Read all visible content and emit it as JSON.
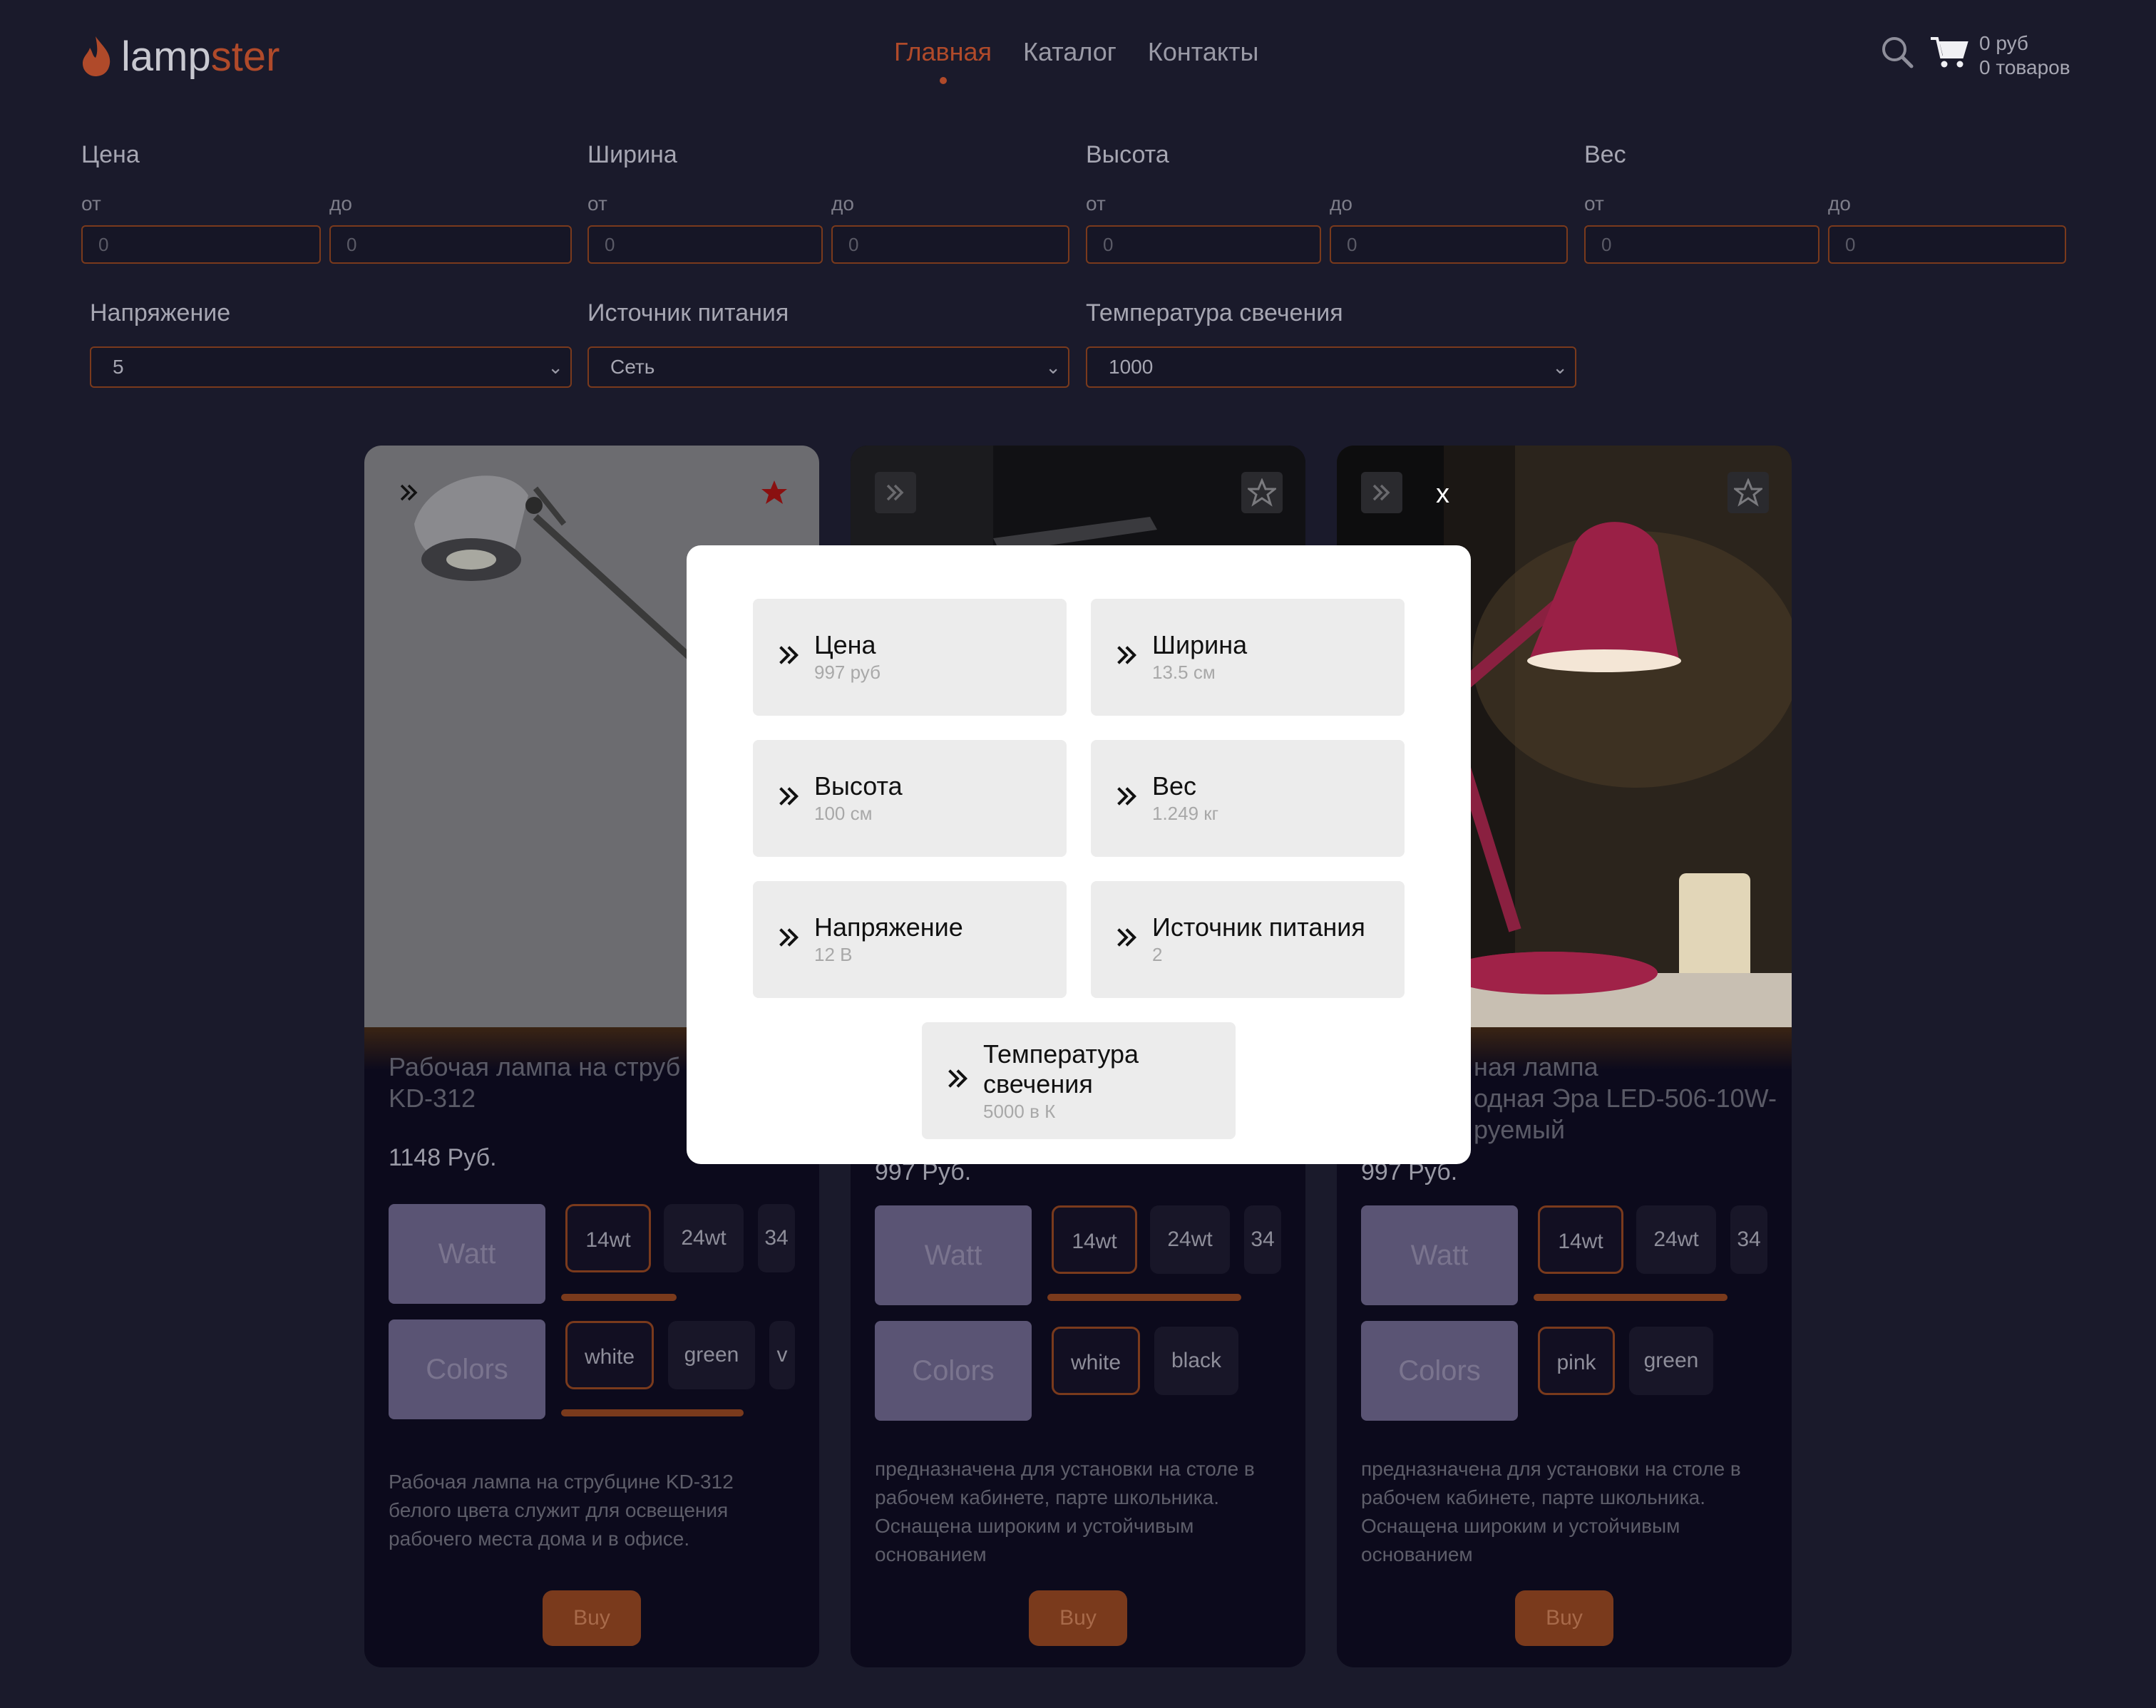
{
  "header": {
    "logo_part1": "lamp",
    "logo_part2": "ster",
    "nav": [
      {
        "label": "Главная",
        "active": true
      },
      {
        "label": "Каталог",
        "active": false
      },
      {
        "label": "Контакты",
        "active": false
      }
    ],
    "cart_total": "0 руб",
    "cart_count": "0 товаров",
    "icons": [
      "search-icon",
      "cart-icon"
    ]
  },
  "filters": {
    "ranges": [
      {
        "label": "Цена",
        "from_label": "от",
        "to_label": "до",
        "from_placeholder": "0",
        "to_placeholder": "0"
      },
      {
        "label": "Ширина",
        "from_label": "от",
        "to_label": "до",
        "from_placeholder": "0",
        "to_placeholder": "0"
      },
      {
        "label": "Высота",
        "from_label": "от",
        "to_label": "до",
        "from_placeholder": "0",
        "to_placeholder": "0"
      },
      {
        "label": "Вес",
        "from_label": "от",
        "to_label": "до",
        "from_placeholder": "0",
        "to_placeholder": "0"
      }
    ],
    "selects": [
      {
        "label": "Напряжение",
        "value": "5"
      },
      {
        "label": "Источник питания",
        "value": "Сеть"
      },
      {
        "label": "Температура свечения",
        "value": "1000"
      }
    ]
  },
  "cards": [
    {
      "title_line1": "Рабочая лампа на струб",
      "title_line2": "KD-312",
      "price": "1148 Руб.",
      "watt_label": "Watt",
      "watts": [
        "14wt",
        "24wt",
        "34"
      ],
      "colors_label": "Colors",
      "colors": [
        "white",
        "green",
        "v"
      ],
      "description": [
        "Рабочая лампа на струбцине KD-312",
        "белого цвета служит для освещения",
        "рабочего места дома и в офисе."
      ],
      "buy_label": "Buy",
      "favorited": true
    },
    {
      "title_line1": "",
      "title_line2": "",
      "price": "997 Руб.",
      "watt_label": "Watt",
      "watts": [
        "14wt",
        "24wt",
        "34"
      ],
      "colors_label": "Colors",
      "colors": [
        "white",
        "black"
      ],
      "description": [
        "предназначена для установки на столе в",
        "рабочем кабинете, парте школьника.",
        "Оснащена широким и устойчивым",
        "основанием"
      ],
      "buy_label": "Buy",
      "favorited": false
    },
    {
      "title_line1": "ная лампа",
      "title_line2": "одная Эра LED-506-10W-",
      "title_line3": "руемый",
      "price": "997 Руб.",
      "watt_label": "Watt",
      "watts": [
        "14wt",
        "24wt",
        "34"
      ],
      "colors_label": "Colors",
      "colors": [
        "pink",
        "green"
      ],
      "description": [
        "предназначена для установки на столе в",
        "рабочем кабинете, парте школьника.",
        "Оснащена широким и устойчивым",
        "основанием"
      ],
      "buy_label": "Buy",
      "favorited": false
    }
  ],
  "modal": {
    "close_label": "x",
    "items": [
      {
        "title": "Цена",
        "value": "997 руб"
      },
      {
        "title": "Ширина",
        "value": "13.5 см"
      },
      {
        "title": "Высота",
        "value": "100 см"
      },
      {
        "title": "Вес",
        "value": "1.249 кг"
      },
      {
        "title": "Напряжение",
        "value": "12 В"
      },
      {
        "title": "Источник питания",
        "value": "2"
      },
      {
        "title_line1": "Температура",
        "title_line2": "свечения",
        "value": "5000 в К"
      }
    ]
  },
  "colors": {
    "accent": "#b04a2a",
    "background": "#1a1a2b",
    "card": "#0c0a1c"
  }
}
